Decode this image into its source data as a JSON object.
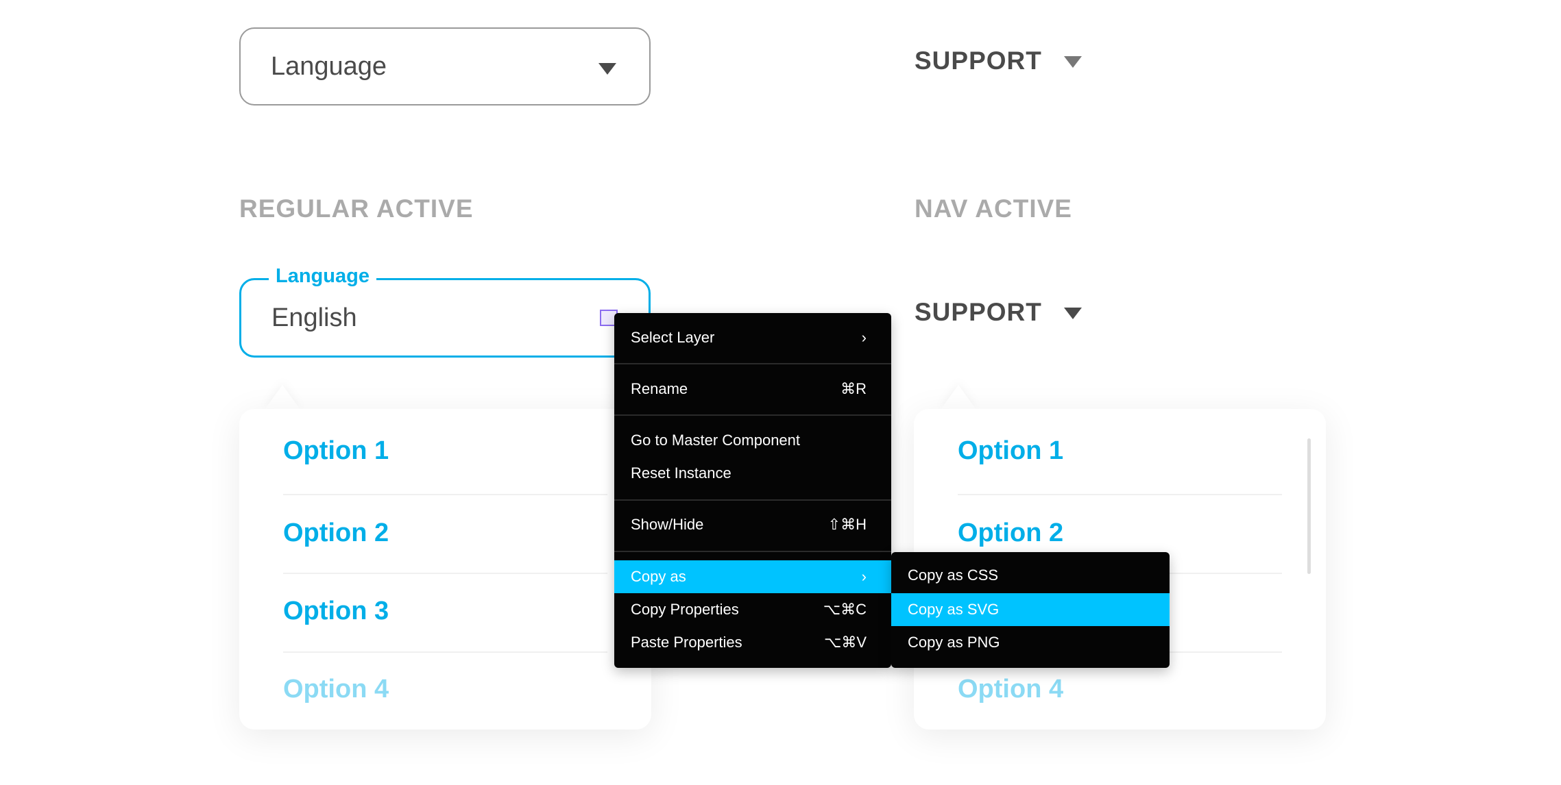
{
  "top": {
    "select_placeholder": "Language",
    "nav_label": "SUPPORT"
  },
  "headings": {
    "regular_active": "REGULAR ACTIVE",
    "nav_active": "NAV ACTIVE"
  },
  "active_select": {
    "label": "Language",
    "value": "English"
  },
  "nav_active": {
    "label": "SUPPORT"
  },
  "options": [
    "Option 1",
    "Option 2",
    "Option 3",
    "Option 4"
  ],
  "context_menu": {
    "items": [
      {
        "label": "Select Layer",
        "shortcut": "›"
      },
      {
        "label": "Rename",
        "shortcut": "⌘R"
      },
      {
        "label": "Go to Master Component",
        "shortcut": ""
      },
      {
        "label": "Reset Instance",
        "shortcut": ""
      },
      {
        "label": "Show/Hide",
        "shortcut": "⇧⌘H"
      },
      {
        "label": "Copy as",
        "shortcut": "›"
      },
      {
        "label": "Copy Properties",
        "shortcut": "⌥⌘C"
      },
      {
        "label": "Paste Properties",
        "shortcut": "⌥⌘V"
      }
    ],
    "highlighted": "Copy as"
  },
  "submenu": {
    "items": [
      "Copy as CSS",
      "Copy as SVG",
      "Copy as PNG"
    ],
    "highlighted": "Copy as SVG"
  },
  "colors": {
    "accent": "#00aee8",
    "menu_highlight": "#00c3ff",
    "menu_bg": "#050505",
    "text": "#4a4a4a",
    "heading": "#aaaaaa"
  }
}
